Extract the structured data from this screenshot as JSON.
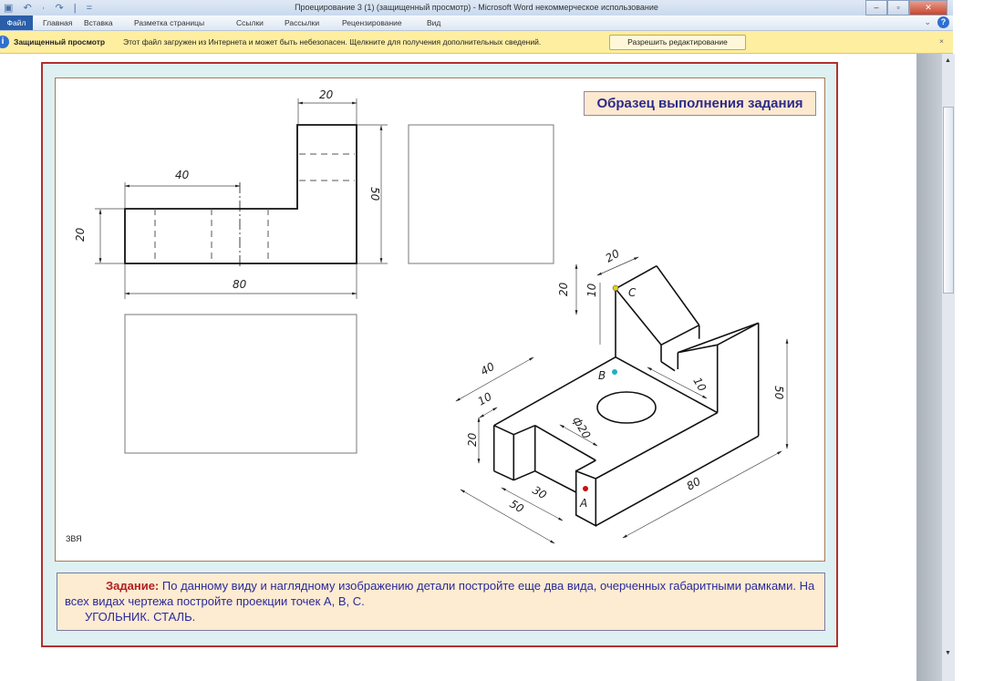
{
  "window": {
    "title": "Проецирование 3 (1) (защищенный просмотр) - Microsoft Word некоммерческое использование",
    "quick_access": "▣ ↶ · ↷ | ="
  },
  "ribbon": {
    "tabs": [
      "Файл",
      "Главная",
      "Вставка",
      "Разметка страницы",
      "Ссылки",
      "Рассылки",
      "Рецензирование",
      "Вид"
    ],
    "help": "?",
    "minimize": "⌄"
  },
  "protected_view": {
    "title": "Защищенный просмотр",
    "message": "Этот файл загружен из Интернета и может быть небезопасен. Щелкните для получения дополнительных сведений.",
    "enable_button": "Разрешить редактирование",
    "close": "×"
  },
  "document": {
    "sample_title": "Образец выполнения задания",
    "code": "ЗВЯ",
    "task_label": "Задание:",
    "task_text": "По данному виду и наглядному изображению детали постройте еще два вида, очерченных габаритными рамками. На  всех видах чертежа постройте проекции точек А, В, С.",
    "task_line3": "УГОЛЬНИК. СТАЛЬ.",
    "front_view_dims": {
      "d40": "40",
      "d20_top": "20",
      "d50": "50",
      "d20_left": "20",
      "d80": "80"
    },
    "iso_dims": {
      "d20_top": "20",
      "d20_side": "20",
      "d10_side": "10",
      "d40": "40",
      "d10_left": "10",
      "d20_left": "20",
      "phi20": "ф20",
      "d10_right": "10",
      "d50": "50",
      "d80": "80",
      "d30": "30",
      "d50_bottom": "50"
    },
    "points": {
      "A": "A",
      "B": "B",
      "C": "C"
    },
    "point_colors": {
      "A": "#c81010",
      "B": "#20b0c0",
      "C": "#e0d020"
    }
  }
}
